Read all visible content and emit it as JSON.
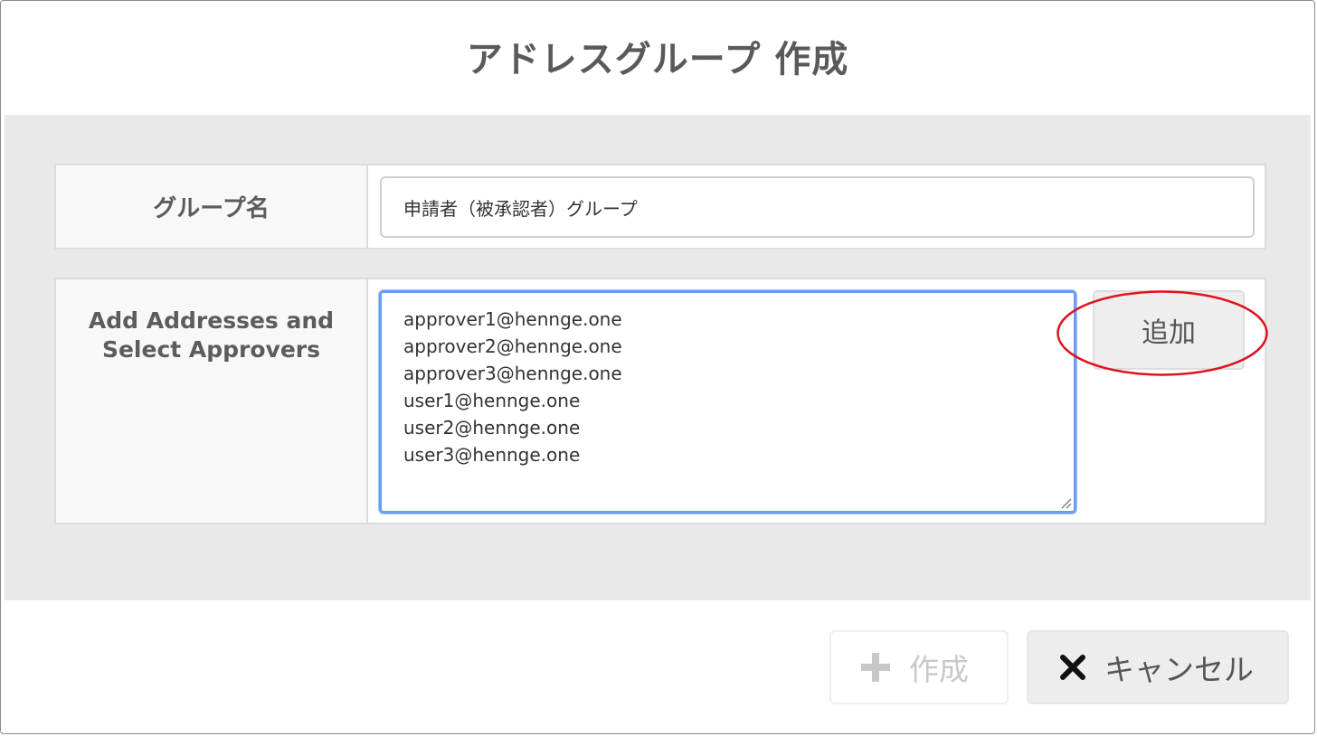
{
  "dialog": {
    "title": "アドレスグループ 作成"
  },
  "form": {
    "group_name": {
      "label": "グループ名",
      "value": "申請者（被承認者）グループ"
    },
    "addresses": {
      "label_line1": "Add Addresses and",
      "label_line2": "Select Approvers",
      "value": "approver1@hennge.one\napprover2@hennge.one\napprover3@hennge.one\nuser1@hennge.one\nuser2@hennge.one\nuser3@hennge.one",
      "add_button_label": "追加"
    }
  },
  "footer": {
    "create_label": "作成",
    "create_icon": "plus-icon",
    "cancel_label": "キャンセル",
    "cancel_icon": "x-icon"
  },
  "colors": {
    "textarea_focus": "#6a9cf0",
    "annotation": "#e0141b",
    "body_bg": "#e9e9e9"
  }
}
